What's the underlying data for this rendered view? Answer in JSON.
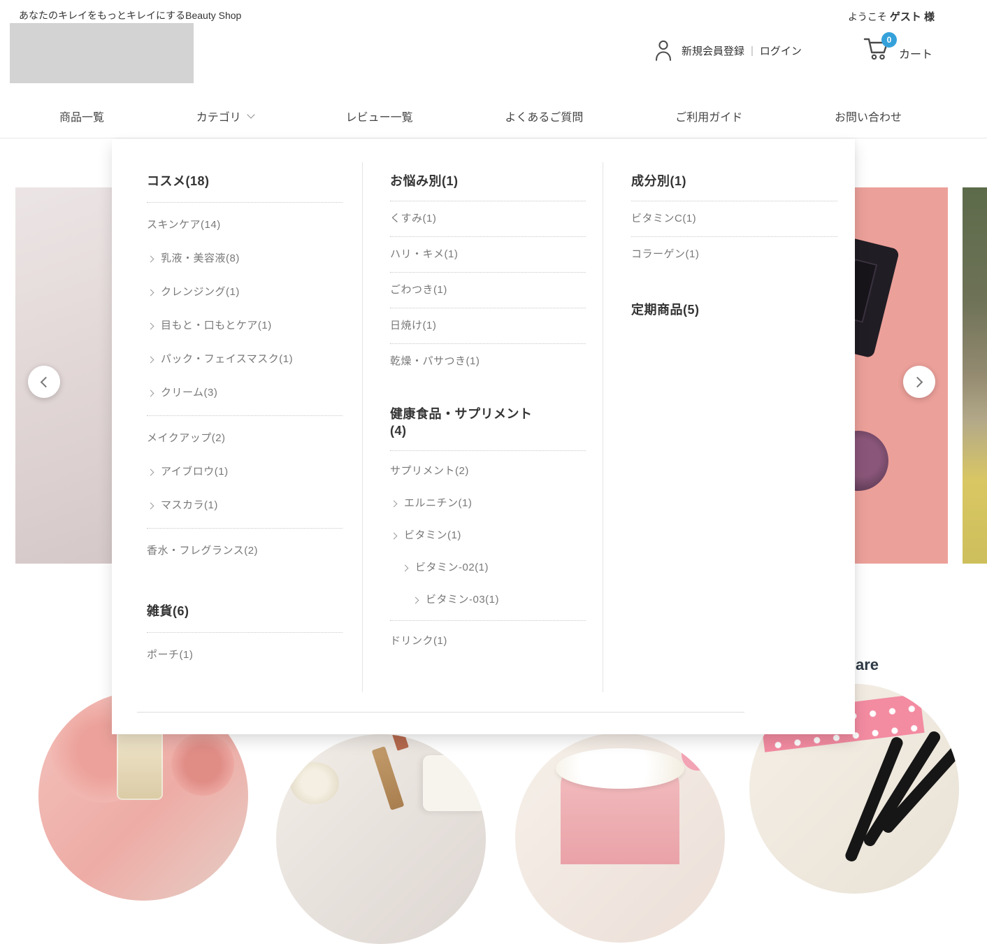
{
  "topbar": {
    "tagline": "あなたのキレイをもっとキレイにするBeauty Shop",
    "welcome_prefix": "ようこそ ",
    "welcome_user": "ゲスト 様"
  },
  "header": {
    "register_label": "新規会員登録",
    "separator": "|",
    "login_label": "ログイン",
    "cart_label": "カート",
    "cart_count": "0"
  },
  "nav": {
    "items": [
      "商品一覧",
      "カテゴリ",
      "レビュー一覧",
      "よくあるご質問",
      "ご利用ガイド",
      "お問い合わせ"
    ]
  },
  "mega_menu": {
    "columns": [
      {
        "entries": [
          {
            "type": "header",
            "label": "コスメ(18)"
          },
          {
            "type": "divider"
          },
          {
            "type": "item",
            "label": "スキンケア(14)"
          },
          {
            "type": "item",
            "label": "乳液・美容液(8)"
          },
          {
            "type": "item",
            "label": "クレンジング(1)"
          },
          {
            "type": "item",
            "label": "目もと・口もとケア(1)"
          },
          {
            "type": "item",
            "label": "パック・フェイスマスク(1)"
          },
          {
            "type": "item",
            "label": "クリーム(3)"
          },
          {
            "type": "divider"
          },
          {
            "type": "item",
            "label": "メイクアップ(2)"
          },
          {
            "type": "item",
            "label": "アイブロウ(1)"
          },
          {
            "type": "item",
            "label": "マスカラ(1)"
          },
          {
            "type": "divider"
          },
          {
            "type": "item",
            "label": "香水・フレグランス(2)"
          },
          {
            "type": "gap"
          },
          {
            "type": "header",
            "label": "雑貨(6)"
          },
          {
            "type": "divider"
          },
          {
            "type": "item",
            "label": "ポーチ(1)"
          }
        ]
      },
      {
        "entries": [
          {
            "type": "header",
            "label": "お悩み別(1)"
          },
          {
            "type": "divider"
          },
          {
            "type": "item",
            "label": "くすみ(1)"
          },
          {
            "type": "divider"
          },
          {
            "type": "item",
            "label": "ハリ・キメ(1)"
          },
          {
            "type": "divider"
          },
          {
            "type": "item",
            "label": "ごわつき(1)"
          },
          {
            "type": "divider"
          },
          {
            "type": "item",
            "label": "日焼け(1)"
          },
          {
            "type": "divider"
          },
          {
            "type": "item",
            "label": "乾燥・パサつき(1)"
          },
          {
            "type": "gap"
          },
          {
            "type": "header",
            "label": "健康食品・サプリメント(4)"
          },
          {
            "type": "divider"
          },
          {
            "type": "item",
            "label": "サプリメント(2)"
          },
          {
            "type": "item",
            "label": "エルニチン(1)"
          },
          {
            "type": "item",
            "label": "ビタミン(1)"
          },
          {
            "type": "item",
            "label": "ビタミン-02(1)"
          },
          {
            "type": "item",
            "label": "ビタミン-03(1)"
          },
          {
            "type": "divider"
          },
          {
            "type": "item",
            "label": "ドリンク(1)"
          }
        ]
      },
      {
        "entries": [
          {
            "type": "header",
            "label": "成分別(1)"
          },
          {
            "type": "divider"
          },
          {
            "type": "item",
            "label": "ビタミンC(1)"
          },
          {
            "type": "divider"
          },
          {
            "type": "item",
            "label": "コラーゲン(1)"
          },
          {
            "type": "gap"
          },
          {
            "type": "header",
            "label": "定期商品(5)"
          }
        ]
      }
    ]
  },
  "hero": {
    "partial_heading": "are"
  },
  "colors": {
    "cart_badge_blue": "#35a1da",
    "hero_pink": "#eca09a",
    "ribbon_pink": "#f38ba1"
  }
}
